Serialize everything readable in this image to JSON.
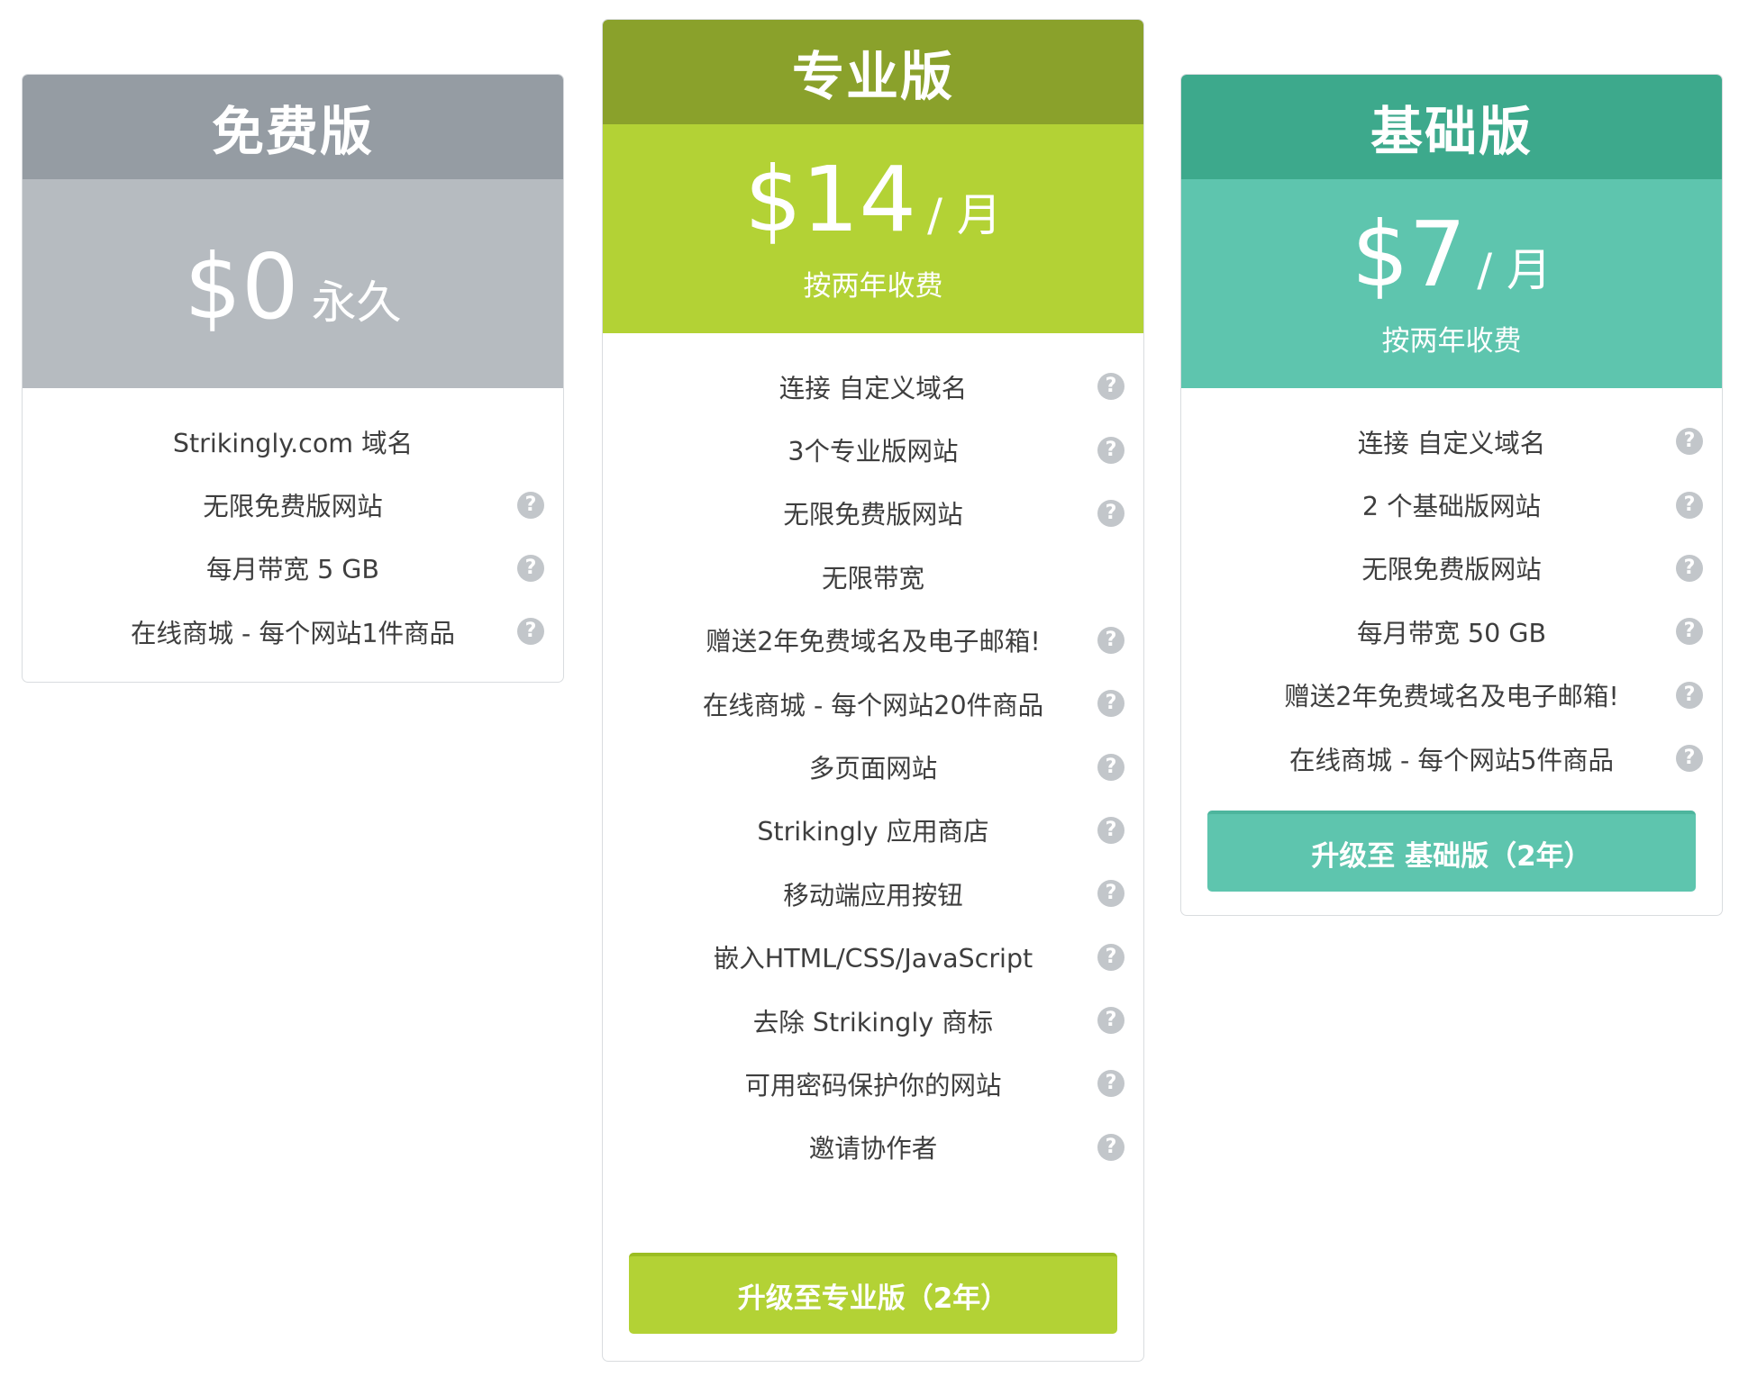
{
  "plans": {
    "free": {
      "name": "免费版",
      "price": "$0",
      "unit": "永久",
      "features": [
        {
          "label": "Strikingly.com 域名",
          "help": false
        },
        {
          "label": "无限免费版网站",
          "help": true
        },
        {
          "label": "每月带宽 5 GB",
          "help": true
        },
        {
          "label": "在线商城 - 每个网站1件商品",
          "help": true
        }
      ]
    },
    "pro": {
      "name": "专业版",
      "price": "$14",
      "unit": "/ 月",
      "note": "按两年收费",
      "features": [
        {
          "label": "连接 自定义域名",
          "help": true
        },
        {
          "label": "3个专业版网站",
          "help": true
        },
        {
          "label": "无限免费版网站",
          "help": true
        },
        {
          "label": "无限带宽",
          "help": false
        },
        {
          "label": "赠送2年免费域名及电子邮箱!",
          "help": true
        },
        {
          "label": "在线商城 - 每个网站20件商品",
          "help": true
        },
        {
          "label": "多页面网站",
          "help": true
        },
        {
          "label": "Strikingly 应用商店",
          "help": true
        },
        {
          "label": "移动端应用按钮",
          "help": true
        },
        {
          "label": "嵌入HTML/CSS/JavaScript",
          "help": true
        },
        {
          "label": "去除 Strikingly 商标",
          "help": true
        },
        {
          "label": "可用密码保护你的网站",
          "help": true
        },
        {
          "label": "邀请协作者",
          "help": true
        }
      ],
      "cta": "升级至专业版（2年）"
    },
    "basic": {
      "name": "基础版",
      "price": "$7",
      "unit": "/ 月",
      "note": "按两年收费",
      "features": [
        {
          "label": "连接 自定义域名",
          "help": true
        },
        {
          "label": "2 个基础版网站",
          "help": true
        },
        {
          "label": "无限免费版网站",
          "help": true
        },
        {
          "label": "每月带宽 50 GB",
          "help": true
        },
        {
          "label": "赠送2年免费域名及电子邮箱!",
          "help": true
        },
        {
          "label": "在线商城 - 每个网站5件商品",
          "help": true
        }
      ],
      "cta": "升级至 基础版（2年）"
    }
  },
  "help_icon": {
    "glyph": "?",
    "icon": "question-circle-icon"
  },
  "colors": {
    "free_header": "#959ca3",
    "free_price": "#b6bbc0",
    "pro_header": "#8aa12b",
    "pro_price": "#b3d235",
    "basic_header": "#3da98c",
    "basic_price": "#5ec5ae"
  }
}
